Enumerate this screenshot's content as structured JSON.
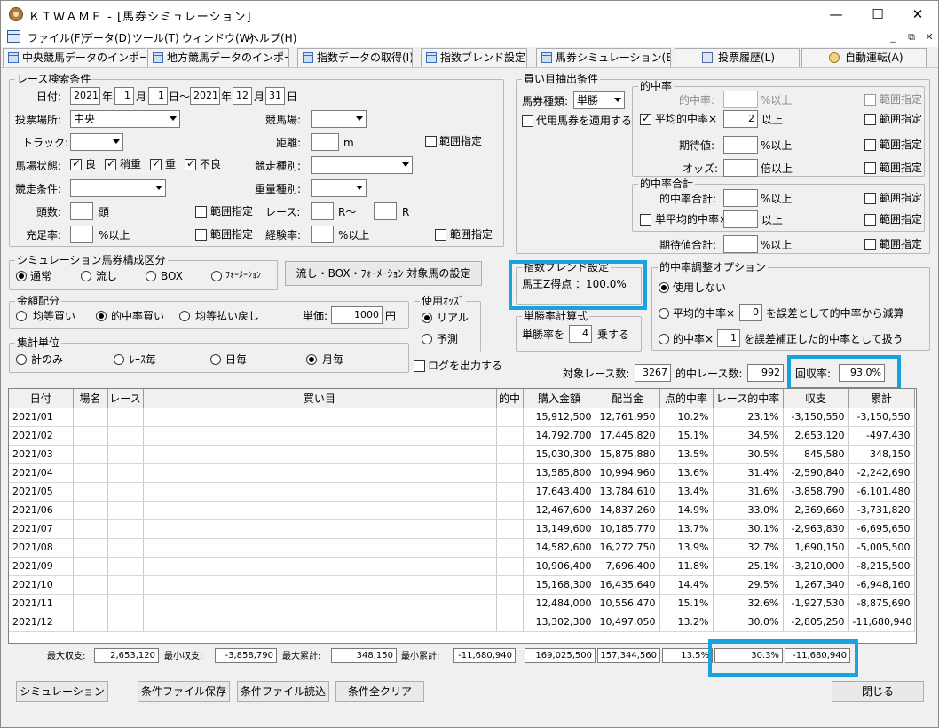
{
  "window": {
    "title": "ＫＩＷＡＭＥ - [馬券シミュレーション]",
    "minimize": "—",
    "maximize": "☐",
    "close": "✕"
  },
  "menu": {
    "items": [
      "ファイル(F)",
      "データ(D)",
      "ツール(T)",
      "ウィンドウ(W)",
      "ヘルプ(H)"
    ],
    "mdi": [
      "_",
      "⧉",
      "✕"
    ]
  },
  "toolbar": {
    "buttons": [
      "中央競馬データのインポート(J)",
      "地方競馬データのインポート(N)",
      "指数データの取得(I)",
      "指数ブレンド設定(D)",
      "馬券シミュレーション(B)",
      "投票履歴(L)",
      "自動運転(A)"
    ]
  },
  "race_search": {
    "title": "レース検索条件",
    "date_label": "日付:",
    "from_year": "2021",
    "year": "年",
    "from_month": "1",
    "month": "月",
    "from_day": "1",
    "day_tilde": "日〜",
    "to_year": "2021",
    "to_month": "12",
    "to_day": "31",
    "day": "日",
    "venue_label": "投票場所:",
    "venue": "中央",
    "course_label": "競馬場:",
    "course": "",
    "track_label": "トラック:",
    "track": "",
    "distance_label": "距離:",
    "distance": "",
    "distance_unit": "m",
    "range_label": "範囲指定",
    "condition_label": "馬場状態:",
    "conditions": [
      {
        "label": "良",
        "checked": true
      },
      {
        "label": "稍重",
        "checked": true
      },
      {
        "label": "重",
        "checked": true
      },
      {
        "label": "不良",
        "checked": true
      }
    ],
    "race_type_label": "競走種別:",
    "race_type": "",
    "race_cond_label": "競走条件:",
    "race_cond": "",
    "weight_type_label": "重量種別:",
    "weight_type": "",
    "heads_label": "頭数:",
    "heads": "",
    "heads_unit": "頭",
    "race_label": "レース:",
    "race_from": "",
    "race_mid": "R〜",
    "race_to": "",
    "race_unit": "R",
    "fill_label": "充足率:",
    "fill": "",
    "fill_unit": "%以上",
    "exp_label": "経験率:",
    "exp": "",
    "exp_unit": "%以上"
  },
  "composition": {
    "title": "シミュレーション馬券構成区分",
    "options": [
      "通常",
      "流し",
      "BOX",
      "ﾌｫｰﾒｰｼｮﾝ"
    ],
    "selected": 0,
    "set_button": "流し・BOX・ﾌｫｰﾒｰｼｮﾝ 対象馬の設定"
  },
  "allocation": {
    "title": "金額配分",
    "options": [
      "均等買い",
      "的中率買い",
      "均等払い戻し"
    ],
    "selected": 1,
    "unit_label": "単価:",
    "unit": "1000",
    "unit_suffix": "円"
  },
  "odds": {
    "title": "使用ｵｯｽﾞ",
    "options": [
      "リアル",
      "予測"
    ],
    "selected": 0
  },
  "aggregate": {
    "title": "集計単位",
    "options": [
      "計のみ",
      "ﾚｰｽ毎",
      "日毎",
      "月毎"
    ],
    "selected": 3
  },
  "log_label": "ログを出力する",
  "extract": {
    "title": "買い目抽出条件",
    "ticket_label": "馬券種類:",
    "ticket": "単勝",
    "substitute_label": "代用馬券を適用する",
    "hit_group": "的中率",
    "hit_rate_label": "的中率:",
    "hit_rate_unit": "%以上",
    "avg_hit_label": "平均的中率×",
    "avg_hit": "2",
    "avg_hit_unit": "以上",
    "expect_label": "期待値:",
    "expect_unit": "%以上",
    "odds_label": "オッズ:",
    "odds_unit": "倍以上",
    "hit_sum_group": "的中率合計",
    "hit_sum_label": "的中率合計:",
    "hit_sum_unit": "%以上",
    "single_avg_label": "単平均的中率×",
    "single_avg_unit": "以上",
    "expect_sum_label": "期待値合計:",
    "expect_sum_unit": "%以上",
    "range_label": "範囲指定"
  },
  "blend": {
    "title": "指数ブレンド設定",
    "text": "馬王Z得点 ：100.0%"
  },
  "hit_adjust": {
    "title": "的中率調整オプション",
    "opt0": "使用しない",
    "opt1_pre": "平均的中率×",
    "opt1_val": "0",
    "opt1_post": "を誤差として的中率から減算",
    "opt2_pre": "的中率×",
    "opt2_val": "1",
    "opt2_post": "を誤差補正した的中率として扱う",
    "selected": 0
  },
  "win_calc": {
    "title": "単勝率計算式",
    "pre": "単勝率を",
    "val": "4",
    "post": "乗する"
  },
  "stats": {
    "races_label": "対象レース数:",
    "races": "3267",
    "hit_label": "的中レース数:",
    "hit": "992",
    "recovery_label": "回収率:",
    "recovery": "93.0%"
  },
  "table": {
    "headers": [
      "日付",
      "場名",
      "レース",
      "買い目",
      "的中",
      "購入金額",
      "配当金",
      "点的中率",
      "レース的中率",
      "収支",
      "累計"
    ],
    "rows": [
      [
        "2021/01",
        "",
        "",
        "",
        "",
        "15,912,500",
        "12,761,950",
        "10.2%",
        "23.1%",
        "-3,150,550",
        "-3,150,550"
      ],
      [
        "2021/02",
        "",
        "",
        "",
        "",
        "14,792,700",
        "17,445,820",
        "15.1%",
        "34.5%",
        "2,653,120",
        "-497,430"
      ],
      [
        "2021/03",
        "",
        "",
        "",
        "",
        "15,030,300",
        "15,875,880",
        "13.5%",
        "30.5%",
        "845,580",
        "348,150"
      ],
      [
        "2021/04",
        "",
        "",
        "",
        "",
        "13,585,800",
        "10,994,960",
        "13.6%",
        "31.4%",
        "-2,590,840",
        "-2,242,690"
      ],
      [
        "2021/05",
        "",
        "",
        "",
        "",
        "17,643,400",
        "13,784,610",
        "13.4%",
        "31.6%",
        "-3,858,790",
        "-6,101,480"
      ],
      [
        "2021/06",
        "",
        "",
        "",
        "",
        "12,467,600",
        "14,837,260",
        "14.9%",
        "33.0%",
        "2,369,660",
        "-3,731,820"
      ],
      [
        "2021/07",
        "",
        "",
        "",
        "",
        "13,149,600",
        "10,185,770",
        "13.7%",
        "30.1%",
        "-2,963,830",
        "-6,695,650"
      ],
      [
        "2021/08",
        "",
        "",
        "",
        "",
        "14,582,600",
        "16,272,750",
        "13.9%",
        "32.7%",
        "1,690,150",
        "-5,005,500"
      ],
      [
        "2021/09",
        "",
        "",
        "",
        "",
        "10,906,400",
        "7,696,400",
        "11.8%",
        "25.1%",
        "-3,210,000",
        "-8,215,500"
      ],
      [
        "2021/10",
        "",
        "",
        "",
        "",
        "15,168,300",
        "16,435,640",
        "14.4%",
        "29.5%",
        "1,267,340",
        "-6,948,160"
      ],
      [
        "2021/11",
        "",
        "",
        "",
        "",
        "12,484,000",
        "10,556,470",
        "15.1%",
        "32.6%",
        "-1,927,530",
        "-8,875,690"
      ],
      [
        "2021/12",
        "",
        "",
        "",
        "",
        "13,302,300",
        "10,497,050",
        "13.2%",
        "30.0%",
        "-2,805,250",
        "-11,680,940"
      ]
    ]
  },
  "summary": {
    "max_profit_label": "最大収支:",
    "max_profit": "2,653,120",
    "min_profit_label": "最小収支:",
    "min_profit": "-3,858,790",
    "max_cum_label": "最大累計:",
    "max_cum": "348,150",
    "min_cum_label": "最小累計:",
    "min_cum": "-11,680,940",
    "total_buy": "169,025,500",
    "total_pay": "157,344,560",
    "point_hit": "13.5%",
    "race_hit": "30.3%",
    "total_profit": "-11,680,940"
  },
  "footer": {
    "simulate": "シミュレーション",
    "save": "条件ファイル保存",
    "load": "条件ファイル読込",
    "clear": "条件全クリア",
    "close": "閉じる"
  }
}
